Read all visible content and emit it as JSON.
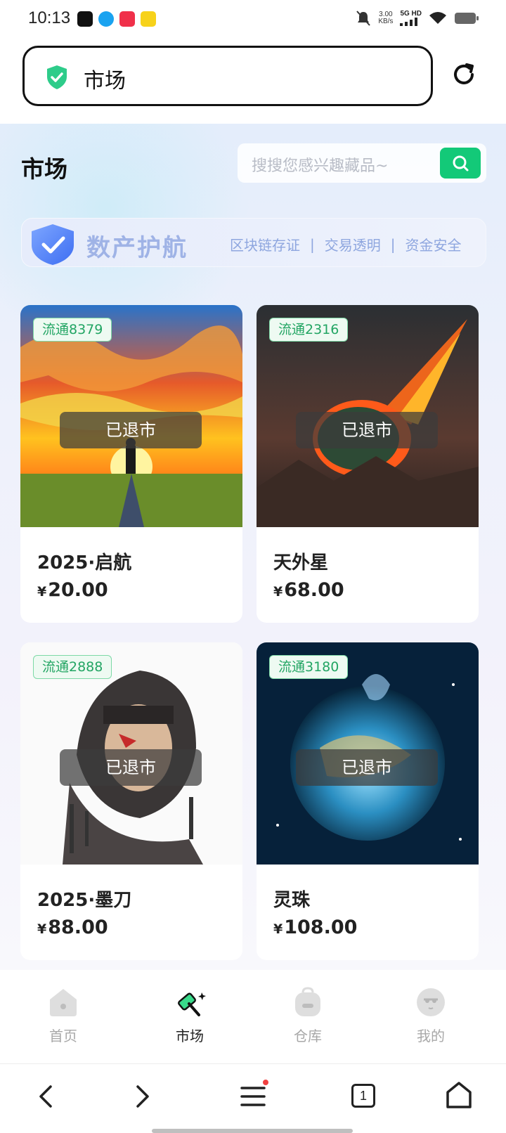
{
  "status": {
    "time": "10:13",
    "net_speed_value": "3.00",
    "net_speed_unit": "KB/s",
    "network": "5G HD"
  },
  "url_bar": {
    "title": "市场",
    "icon": "shield-check-icon"
  },
  "header": {
    "title": "市场",
    "search_placeholder": "搜搜您感兴趣藏品~"
  },
  "banner": {
    "title": "数产护航",
    "tags": [
      "区块链存证",
      "交易透明",
      "资金安全"
    ],
    "separator": "|"
  },
  "products": [
    {
      "circulation": "流通8379",
      "status": "已退市",
      "name": "2025·启航",
      "currency": "¥",
      "price": "20.00"
    },
    {
      "circulation": "流通2316",
      "status": "已退市",
      "name": "天外星",
      "currency": "¥",
      "price": "68.00"
    },
    {
      "circulation": "流通2888",
      "status": "已退市",
      "name": "2025·墨刀",
      "currency": "¥",
      "price": "88.00"
    },
    {
      "circulation": "流通3180",
      "status": "已退市",
      "name": "灵珠",
      "currency": "¥",
      "price": "108.00"
    }
  ],
  "tabs": [
    {
      "label": "首页",
      "icon": "home-icon",
      "active": false
    },
    {
      "label": "市场",
      "icon": "market-hammer-icon",
      "active": true
    },
    {
      "label": "仓库",
      "icon": "backpack-icon",
      "active": false
    },
    {
      "label": "我的",
      "icon": "profile-icon",
      "active": false
    }
  ],
  "browser_nav": {
    "tab_count": "1"
  },
  "colors": {
    "accent_green": "#13c978",
    "tag_green": "#22a563",
    "banner_blue": "#9fb3e6"
  }
}
